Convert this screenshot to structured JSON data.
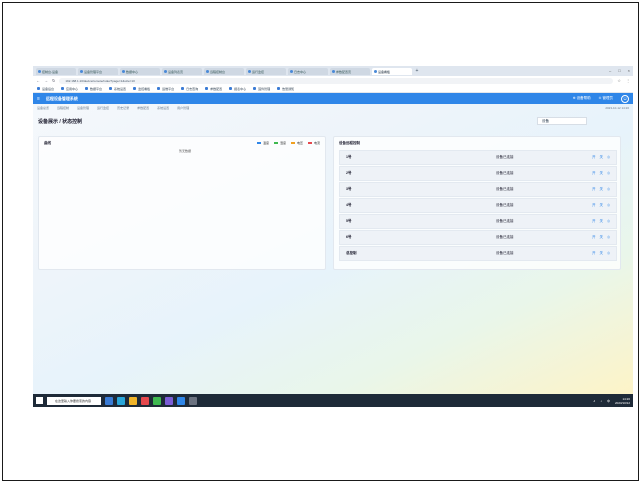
{
  "browser": {
    "tabs": [
      {
        "label": "控制台-设备"
      },
      {
        "label": "设备管理平台"
      },
      {
        "label": "数据中心"
      },
      {
        "label": "设备列表页"
      },
      {
        "label": "远程控制台"
      },
      {
        "label": "运行监控"
      },
      {
        "label": "日志中心"
      },
      {
        "label": "参数配置页"
      },
      {
        "label": "设备看板"
      }
    ],
    "new_tab": "+",
    "window_controls": [
      "–",
      "□",
      "×"
    ],
    "url": "192.168.1.10/device/remote/index?page=1&size=10",
    "nav": [
      "←",
      "→",
      "↻"
    ],
    "addr_icons": [
      "☆",
      "⋮"
    ]
  },
  "bookmarks": [
    "设备后台",
    "应用中心",
    "数据平台",
    "系统设置",
    "监控看板",
    "运维平台",
    "日志查询",
    "参数配置",
    "报表中心",
    "固件管理",
    "告警通知"
  ],
  "app": {
    "title": "远程设备管理系统",
    "menu_icon": "≡",
    "right_items": [
      "⊕ 设备帮助",
      "⊙ 管理员"
    ],
    "avatar_glyph": "☺"
  },
  "subnav": {
    "items": [
      "设备总览",
      "远程控制",
      "设备管理",
      "运行监控",
      "历史记录",
      "参数配置",
      "系统设置",
      "用户管理"
    ],
    "right": "2023-10-12 14:20"
  },
  "page": {
    "title": "设备展示 / 状态控制",
    "control_label": "设备"
  },
  "left_panel": {
    "title": "曲线",
    "legend": [
      {
        "label": "温度",
        "color": "#2f86e8"
      },
      {
        "label": "湿度",
        "color": "#3fb950"
      },
      {
        "label": "电压",
        "color": "#f0a020"
      },
      {
        "label": "电流",
        "color": "#e5484d"
      }
    ],
    "chart_center_label": "暂无数据"
  },
  "right_panel": {
    "title": "设备远程控制",
    "rows": [
      {
        "name": "1号",
        "status": "设备已连接",
        "actions": [
          "开",
          "关",
          "◎"
        ]
      },
      {
        "name": "2号",
        "status": "设备已连接",
        "actions": [
          "开",
          "关",
          "◎"
        ]
      },
      {
        "name": "3号",
        "status": "设备已连接",
        "actions": [
          "开",
          "关",
          "◎"
        ]
      },
      {
        "name": "4号",
        "status": "设备已连接",
        "actions": [
          "开",
          "关",
          "◎"
        ]
      },
      {
        "name": "5号",
        "status": "设备已连接",
        "actions": [
          "开",
          "关",
          "◎"
        ]
      },
      {
        "name": "6号",
        "status": "设备已连接",
        "actions": [
          "开",
          "关",
          "◎"
        ]
      },
      {
        "name": "总控制",
        "status": "设备已连接",
        "actions": [
          "开",
          "关",
          "◎"
        ]
      }
    ]
  },
  "taskbar": {
    "search_text": "在这里输入你要搜索的内容",
    "apps": [
      "#3a7bd5",
      "#2aa6d9",
      "#f0b429",
      "#e5484d",
      "#3fb950",
      "#7b5cd6",
      "#2f86e8",
      "#6b7280"
    ],
    "tray": [
      "∧",
      "♪",
      "中"
    ],
    "time": "14:20",
    "date": "2023/10/12"
  }
}
